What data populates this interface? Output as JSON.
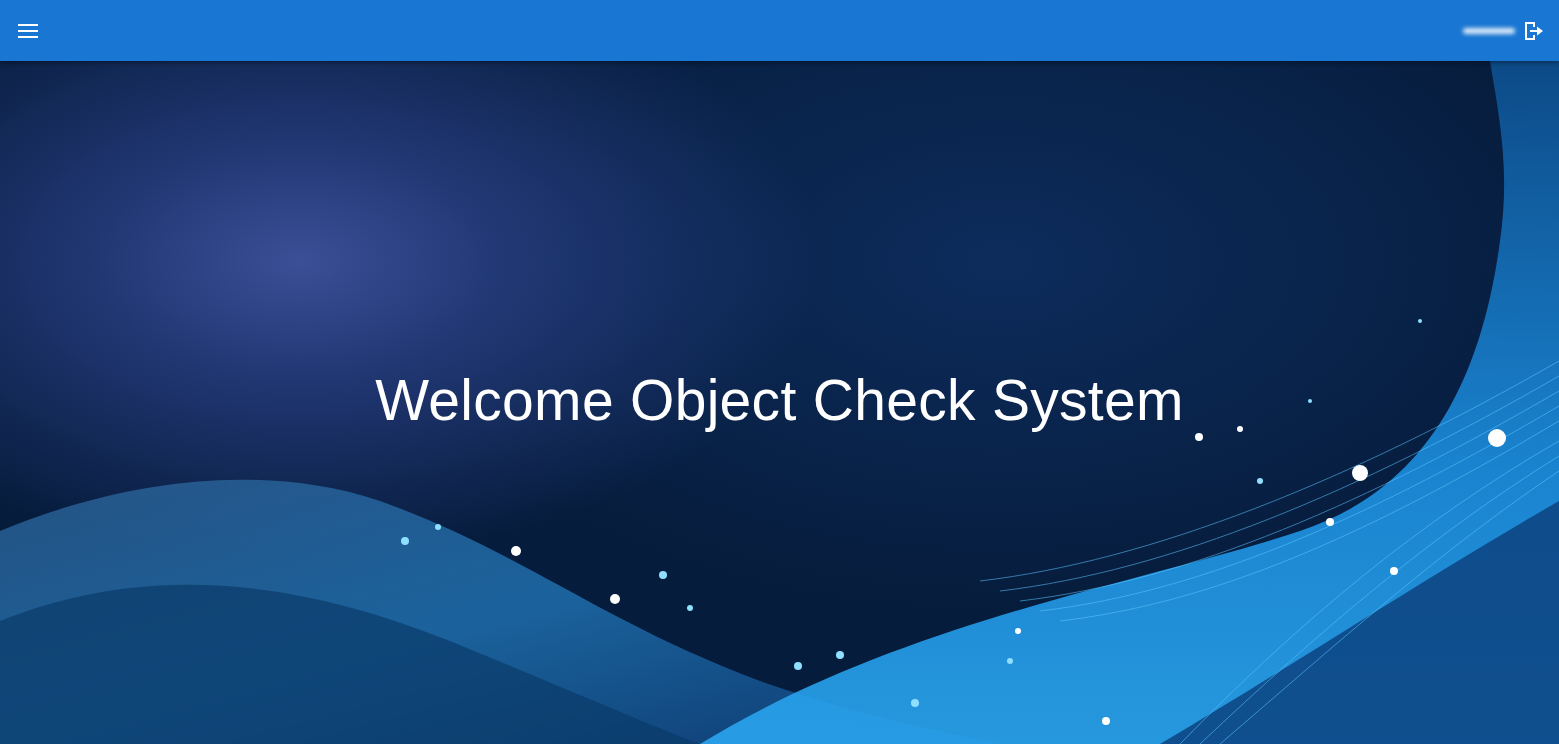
{
  "hero": {
    "title": "Welcome Object Check System"
  }
}
